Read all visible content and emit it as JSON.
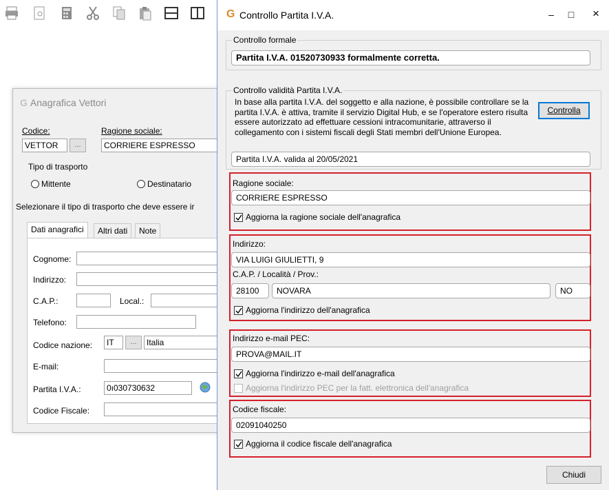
{
  "toolbar": {
    "icons": [
      "print-icon",
      "print-preview-icon",
      "calculator-icon",
      "cut-icon",
      "copy-icon",
      "paste-icon",
      "layout-rows-icon",
      "layout-columns-icon"
    ]
  },
  "background_window": {
    "title": "Anagrafica Vettori",
    "codice_label": "Codice:",
    "codice_value": "VETTOR",
    "lookup_button": "...",
    "ragione_label": "Ragione sociale:",
    "ragione_value": "CORRIERE ESPRESSO",
    "tipo_trasporto_label": "Tipo di trasporto",
    "radio_mittente": "Mittente",
    "radio_destinatario": "Destinatario",
    "hint": "Selezionare il tipo di trasporto che deve essere ir",
    "tabs": [
      "Dati anagrafici",
      "Altri dati",
      "Note"
    ],
    "cognome_label": "Cognome:",
    "indirizzo_label": "Indirizzo:",
    "cap_label": "C.A.P.:",
    "local_label": "Local.:",
    "telefono_label": "Telefono:",
    "codice_nazione_label": "Codice nazione:",
    "codice_nazione_value": "IT",
    "nazione_lookup": "...",
    "nazione_value": "Italia",
    "email_label": "E-mail:",
    "piva_label": "Partita I.V.A.:",
    "piva_value": "0ı030730632",
    "codice_fiscale_label": "Codice Fiscale:"
  },
  "dialog": {
    "title": "Controllo Partita I.V.A.",
    "minimize": "–",
    "maximize": "□",
    "close": "×",
    "controllo_formale": {
      "label": "Controllo formale",
      "message": "Partita I.V.A. 01520730933 formalmente corretta."
    },
    "controllo_validita": {
      "label": "Controllo validità Partita I.V.A.",
      "description": "In base alla partita I.V.A. del soggetto e alla nazione, è possibile controllare se la partita I.V.A. è attiva, tramite il servizio Digital Hub, e se l'operatore estero risulta essere autorizzato ad effettuare cessioni intracomunitarie, attraverso il collegamento con i sistemi fiscali degli Stati membri dell'Unione Europea.",
      "button": "Controlla",
      "result": "Partita I.V.A. valida al 20/05/2021"
    },
    "ragione_sociale": {
      "label": "Ragione sociale:",
      "value": "CORRIERE ESPRESSO",
      "checkbox": "Aggiorna la ragione sociale dell'anagrafica",
      "checked": true
    },
    "indirizzo": {
      "label": "Indirizzo:",
      "value": "VIA LUIGI GIULIETTI, 9",
      "cap_label": "C.A.P. / Località / Prov.:",
      "cap": "28100",
      "localita": "NOVARA",
      "prov": "NO",
      "checkbox": "Aggiorna l'indirizzo dell'anagrafica",
      "checked": true
    },
    "pec": {
      "label": "Indirizzo e-mail PEC:",
      "value": "PROVA@MAIL.IT",
      "checkbox": "Aggiorna l'indirizzo e-mail dell'anagrafica",
      "checked": true,
      "checkbox2": "Aggiorna l'indirizzo PEC per la fatt. elettronica dell'anagrafica",
      "checked2": false
    },
    "codice_fiscale": {
      "label": "Codice fiscale:",
      "value": "02091040250",
      "checkbox": "Aggiorna il codice fiscale dell'anagrafica",
      "checked": true
    },
    "close_button": "Chiudi"
  },
  "colors": {
    "highlight_red": "#d4202a",
    "focus_blue": "#0078d7",
    "logo_orange": "#d98a2b"
  }
}
